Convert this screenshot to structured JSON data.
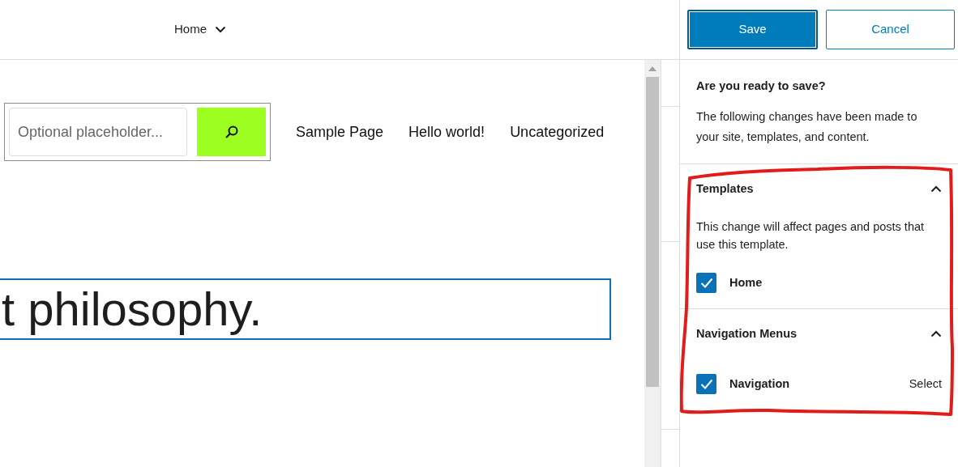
{
  "top_bar": {
    "template": "Home"
  },
  "canvas": {
    "search": {
      "placeholder": "Optional placeholder..."
    },
    "nav_links": [
      "Sample Page",
      "Hello world!",
      "Uncategorized"
    ],
    "heading": "t philosophy."
  },
  "save_panel": {
    "buttons": [
      {
        "label": "Save",
        "kind": "primary"
      },
      {
        "label": "Cancel",
        "kind": "secondary"
      }
    ],
    "title": "Are you ready to save?",
    "description": "The following changes have been made to your site, templates, and content.",
    "sections": [
      {
        "title": "Templates",
        "expanded": true,
        "note": "This change will affect pages and posts that use this template.",
        "items": [
          {
            "label": "Home",
            "checked": true
          }
        ]
      },
      {
        "title": "Navigation Menus",
        "expanded": true,
        "items": [
          {
            "label": "Navigation",
            "checked": true,
            "action": "Select"
          }
        ]
      }
    ]
  }
}
